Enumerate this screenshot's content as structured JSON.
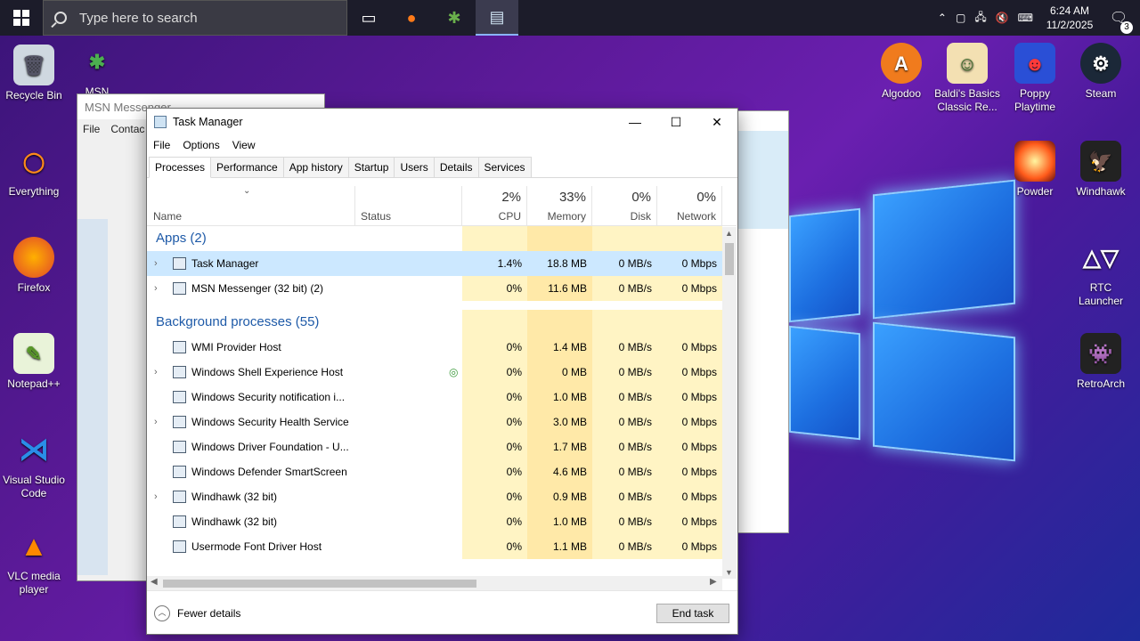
{
  "taskbar": {
    "search_placeholder": "Type here to search",
    "time": "6:24 AM",
    "date": "11/2/2025",
    "notification_count": "3"
  },
  "desktop": {
    "left_icons": [
      {
        "label": "Recycle Bin"
      },
      {
        "label": "MSN"
      },
      {
        "label": "Everything"
      },
      {
        "label": "Firefox"
      },
      {
        "label": "Notepad++"
      },
      {
        "label": "Visual Studio Code"
      },
      {
        "label": "VLC media player"
      }
    ],
    "right_icons": [
      {
        "label": "Algodoo"
      },
      {
        "label": "Baldi's Basics Classic Re..."
      },
      {
        "label": "Poppy Playtime"
      },
      {
        "label": "Steam"
      },
      {
        "label": "Powder"
      },
      {
        "label": "Windhawk"
      },
      {
        "label": "RTC Launcher"
      },
      {
        "label": "RetroArch"
      }
    ]
  },
  "msn_window": {
    "title": "MSN Messenger",
    "menu": [
      "File",
      "Contac"
    ]
  },
  "task_manager": {
    "title": "Task Manager",
    "menu": [
      "File",
      "Options",
      "View"
    ],
    "tabs": [
      "Processes",
      "Performance",
      "App history",
      "Startup",
      "Users",
      "Details",
      "Services"
    ],
    "headers": {
      "name": "Name",
      "status": "Status",
      "cpu_pct": "2%",
      "cpu": "CPU",
      "memory_pct": "33%",
      "memory": "Memory",
      "disk_pct": "0%",
      "disk": "Disk",
      "network_pct": "0%",
      "network": "Network"
    },
    "groups": {
      "apps": "Apps (2)",
      "background": "Background processes (55)"
    },
    "apps": [
      {
        "name": "Task Manager",
        "cpu": "1.4%",
        "memory": "18.8 MB",
        "disk": "0 MB/s",
        "network": "0 Mbps",
        "expandable": "›"
      },
      {
        "name": "MSN Messenger (32 bit) (2)",
        "cpu": "0%",
        "memory": "11.6 MB",
        "disk": "0 MB/s",
        "network": "0 Mbps",
        "expandable": "›"
      }
    ],
    "background": [
      {
        "name": "WMI Provider Host",
        "cpu": "0%",
        "memory": "1.4 MB",
        "disk": "0 MB/s",
        "network": "0 Mbps",
        "expandable": ""
      },
      {
        "name": "Windows Shell Experience Host",
        "cpu": "0%",
        "memory": "0 MB",
        "disk": "0 MB/s",
        "network": "0 Mbps",
        "expandable": "›"
      },
      {
        "name": "Windows Security notification i...",
        "cpu": "0%",
        "memory": "1.0 MB",
        "disk": "0 MB/s",
        "network": "0 Mbps",
        "expandable": ""
      },
      {
        "name": "Windows Security Health Service",
        "cpu": "0%",
        "memory": "3.0 MB",
        "disk": "0 MB/s",
        "network": "0 Mbps",
        "expandable": "›"
      },
      {
        "name": "Windows Driver Foundation - U...",
        "cpu": "0%",
        "memory": "1.7 MB",
        "disk": "0 MB/s",
        "network": "0 Mbps",
        "expandable": ""
      },
      {
        "name": "Windows Defender SmartScreen",
        "cpu": "0%",
        "memory": "4.6 MB",
        "disk": "0 MB/s",
        "network": "0 Mbps",
        "expandable": ""
      },
      {
        "name": "Windhawk (32 bit)",
        "cpu": "0%",
        "memory": "0.9 MB",
        "disk": "0 MB/s",
        "network": "0 Mbps",
        "expandable": "›"
      },
      {
        "name": "Windhawk (32 bit)",
        "cpu": "0%",
        "memory": "1.0 MB",
        "disk": "0 MB/s",
        "network": "0 Mbps",
        "expandable": ""
      },
      {
        "name": "Usermode Font Driver Host",
        "cpu": "0%",
        "memory": "1.1 MB",
        "disk": "0 MB/s",
        "network": "0 Mbps",
        "expandable": ""
      }
    ],
    "fewer_details": "Fewer details",
    "end_task": "End task"
  }
}
